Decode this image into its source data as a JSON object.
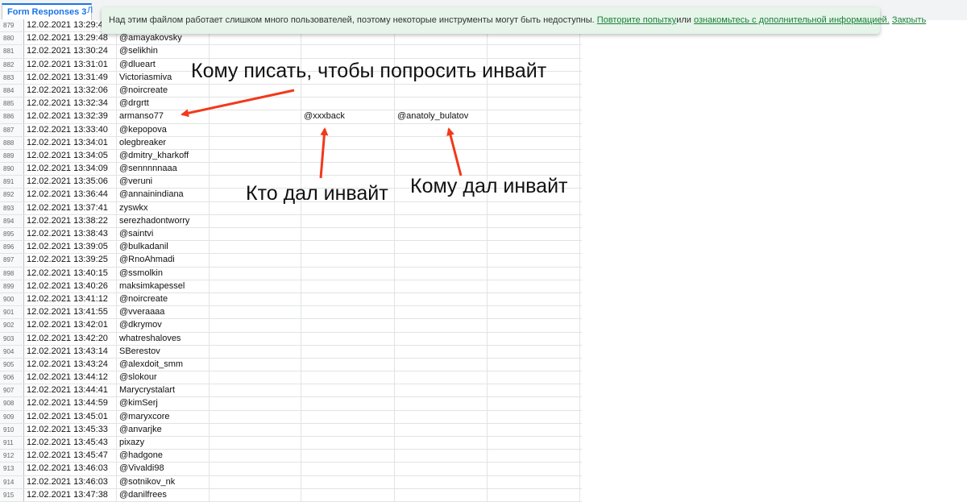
{
  "tabs": {
    "active": "Form Responses 3",
    "second": "Л"
  },
  "notice": {
    "text": "Над этим файлом работает слишком много пользователей, поэтому некоторые инструменты могут быть недоступны.",
    "retry": "Повторите попытку",
    "or": "или",
    "more": "ознакомьтесь с дополнительной информацией.",
    "close": "Закрыть"
  },
  "rows": [
    {
      "num": "879",
      "date": "12.02.2021 13:29:4",
      "user": ""
    },
    {
      "num": "880",
      "date": "12.02.2021 13:29:48",
      "user": "@amayakovsky"
    },
    {
      "num": "881",
      "date": "12.02.2021 13:30:24",
      "user": "@selikhin"
    },
    {
      "num": "882",
      "date": "12.02.2021 13:31:01",
      "user": "@dlueart"
    },
    {
      "num": "883",
      "date": "12.02.2021 13:31:49",
      "user": "Victoriasmiva"
    },
    {
      "num": "884",
      "date": "12.02.2021 13:32:06",
      "user": "@noircreate"
    },
    {
      "num": "885",
      "date": "12.02.2021 13:32:34",
      "user": "@drgrtt"
    },
    {
      "num": "886",
      "date": "12.02.2021 13:32:39",
      "user": "armanso77",
      "e2": "@xxxback",
      "e3": "@anatoly_bulatov"
    },
    {
      "num": "887",
      "date": "12.02.2021 13:33:40",
      "user": "@kepopova"
    },
    {
      "num": "888",
      "date": "12.02.2021 13:34:01",
      "user": "olegbreaker"
    },
    {
      "num": "889",
      "date": "12.02.2021 13:34:05",
      "user": "@dmitry_kharkoff"
    },
    {
      "num": "890",
      "date": "12.02.2021 13:34:09",
      "user": "@sennnnnaaa"
    },
    {
      "num": "891",
      "date": "12.02.2021 13:35:06",
      "user": "@veruni"
    },
    {
      "num": "892",
      "date": "12.02.2021 13:36:44",
      "user": "@annainindiana"
    },
    {
      "num": "893",
      "date": "12.02.2021 13:37:41",
      "user": "zyswkx"
    },
    {
      "num": "894",
      "date": "12.02.2021 13:38:22",
      "user": "serezhadontworry"
    },
    {
      "num": "895",
      "date": "12.02.2021 13:38:43",
      "user": "@saintvi"
    },
    {
      "num": "896",
      "date": "12.02.2021 13:39:05",
      "user": "@bulkadanil"
    },
    {
      "num": "897",
      "date": "12.02.2021 13:39:25",
      "user": "@RnoAhmadi"
    },
    {
      "num": "898",
      "date": "12.02.2021 13:40:15",
      "user": "@ssmolkin"
    },
    {
      "num": "899",
      "date": "12.02.2021 13:40:26",
      "user": "maksimkapessel"
    },
    {
      "num": "900",
      "date": "12.02.2021 13:41:12",
      "user": "@noircreate"
    },
    {
      "num": "901",
      "date": "12.02.2021 13:41:55",
      "user": "@vveraaaa"
    },
    {
      "num": "902",
      "date": "12.02.2021 13:42:01",
      "user": "@dkrymov"
    },
    {
      "num": "903",
      "date": "12.02.2021 13:42:20",
      "user": "whatreshaloves"
    },
    {
      "num": "904",
      "date": "12.02.2021 13:43:14",
      "user": "SBerestov"
    },
    {
      "num": "905",
      "date": "12.02.2021 13:43:24",
      "user": "@alexdoit_smm"
    },
    {
      "num": "906",
      "date": "12.02.2021 13:44:12",
      "user": "@slokour"
    },
    {
      "num": "907",
      "date": "12.02.2021 13:44:41",
      "user": "Marycrystalart"
    },
    {
      "num": "908",
      "date": "12.02.2021 13:44:59",
      "user": "@kimSerj"
    },
    {
      "num": "909",
      "date": "12.02.2021 13:45:01",
      "user": "@maryxcore"
    },
    {
      "num": "910",
      "date": "12.02.2021 13:45:33",
      "user": "@anvarjke"
    },
    {
      "num": "911",
      "date": "12.02.2021 13:45:43",
      "user": "pixazy"
    },
    {
      "num": "912",
      "date": "12.02.2021 13:45:47",
      "user": "@hadgone"
    },
    {
      "num": "913",
      "date": "12.02.2021 13:46:03",
      "user": "@Vivaldi98"
    },
    {
      "num": "914",
      "date": "12.02.2021 13:46:03",
      "user": "@sotnikov_nk"
    },
    {
      "num": "915",
      "date": "12.02.2021 13:47:38",
      "user": "@danilfrees"
    }
  ],
  "annotations": {
    "whom_to_write": "Кому писать, чтобы попросить инвайт",
    "who_gave": "Кто дал инвайт",
    "gave_to": "Кому дал инвайт"
  },
  "colors": {
    "arrow": "#f2391b",
    "notice_bg": "#e6f4ea",
    "link": "#188038",
    "tab_accent": "#1a73e8"
  }
}
